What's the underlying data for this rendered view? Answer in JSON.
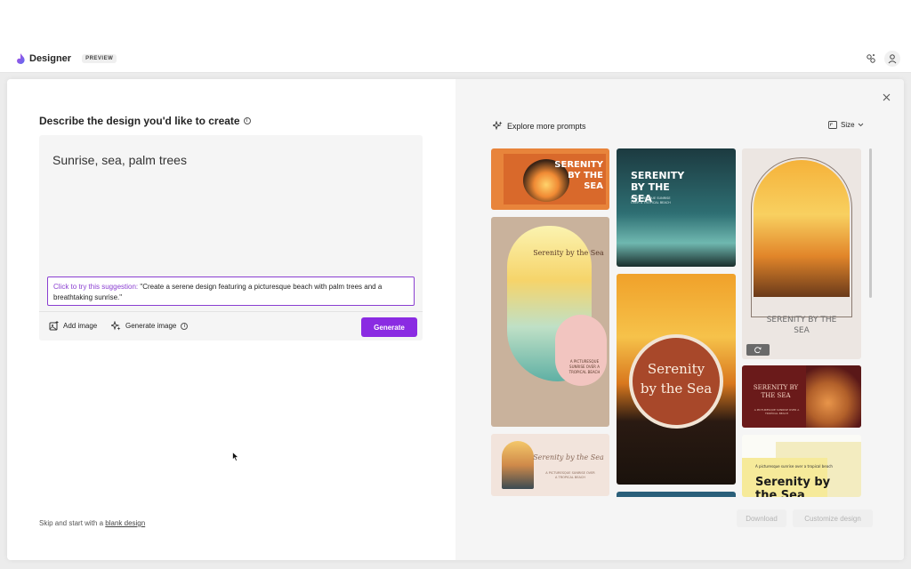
{
  "app": {
    "title": "Designer",
    "badge": "PREVIEW"
  },
  "left": {
    "heading": "Describe the design you'd like to create",
    "prompt": "Sunrise, sea, palm trees",
    "suggestion_prefix": "Click to try this suggestion:",
    "suggestion_text": " \"Create a serene design featuring a picturesque beach with palm trees and a breathtaking sunrise.\"",
    "add_image": "Add image",
    "generate_image": "Generate image",
    "generate": "Generate",
    "skip_prefix": "Skip and start with a ",
    "skip_link": "blank design"
  },
  "right": {
    "explore": "Explore more prompts",
    "size": "Size",
    "download": "Download",
    "customize": "Customize design"
  },
  "cards": {
    "c1_title": "SERENITY BY THE SEA",
    "c2_title": "SERENITY BY THE SEA",
    "c2_sub": "A PICTURESQUE SUNRISE OVER A TROPICAL BEACH",
    "c3_title": "SERENITY BY THE SEA",
    "c4_title": "Serenity by the Sea",
    "c4_sub": "A PICTURESQUE SUNRISE OVER A TROPICAL BEACH",
    "c5_title": "Serenity by the Sea",
    "c6_title": "SERENITY BY THE SEA",
    "c6_sub": "A PICTURESQUE SUNRISE OVER A TROPICAL BEACH",
    "c7_title": "Serenity by the Sea",
    "c7_sub": "A PICTURESQUE SUNRISE OVER A TROPICAL BEACH",
    "c8_sub": "A picturesque sunrise over a tropical beach",
    "c8_title": "Serenity by the Sea"
  },
  "colors": {
    "accent": "#8a2be2",
    "suggestion_border": "#8a3fd1"
  }
}
